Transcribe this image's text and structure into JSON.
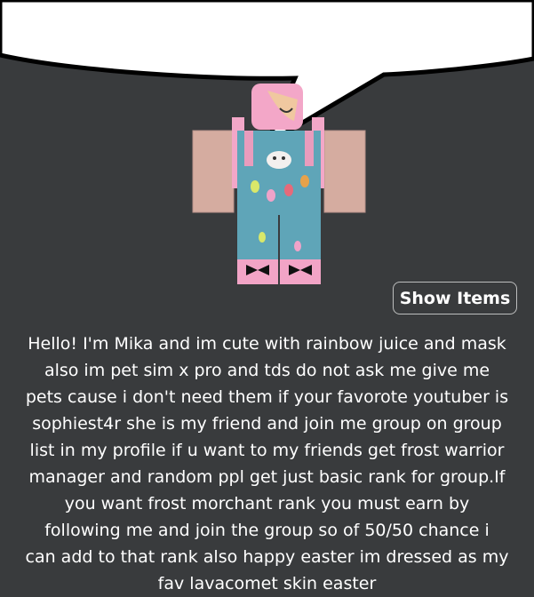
{
  "avatar": {
    "character": "Mika",
    "outfit": "pink-hair-blue-bunny-overalls-with-easter-eggs"
  },
  "show_items_button": {
    "label": "Show Items"
  },
  "description": {
    "text": "Hello! I'm Mika and im cute with rainbow juice and mask\nalso im pet sim x pro and tds do not ask me give me\npets cause i don't need them if your favorote youtuber is\nsophiest4r she is my friend and join me group  on group\nlist in my profile if u want to my friends get frost warrior\nmanager and random ppl get just basic rank for group.If\nyou want frost morchant rank you must earn by\nfollowing me and join the group so of 50/50 chance i\ncan add to that rank also happy easter im dressed as my\nfav lavacomet skin easter"
  },
  "colors": {
    "background": "#393b3d",
    "bubble_fill": "#ffffff",
    "bubble_outline": "#000000",
    "text": "#ffffff",
    "button_border": "#bdbebe"
  }
}
